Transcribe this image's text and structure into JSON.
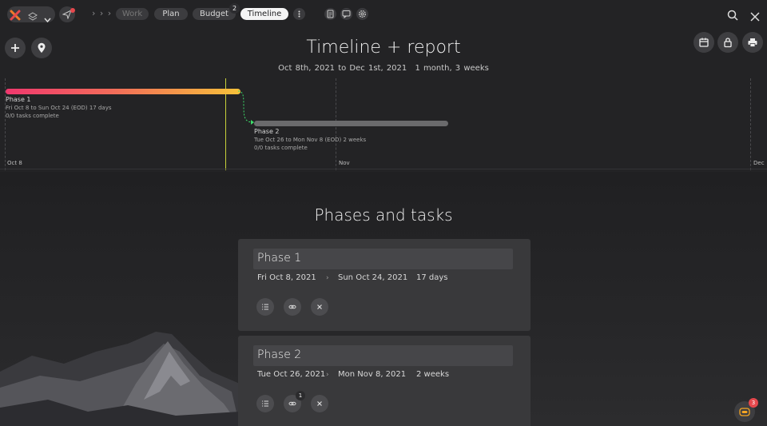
{
  "topbar": {
    "crumbs": "› › ›",
    "tabs": [
      {
        "label": "Work"
      },
      {
        "label": "Plan"
      },
      {
        "label": "Budget",
        "badge": "2"
      },
      {
        "label": "Timeline"
      }
    ]
  },
  "header": {
    "title": "Timeline + report",
    "date_range": "Oct 8th, 2021 to Dec 1st, 2021",
    "duration": "1 month, 3 weeks"
  },
  "timeline": {
    "months": [
      "Oct 8",
      "Nov",
      "Dec"
    ],
    "phases": [
      {
        "name": "Phase 1",
        "range": "Fri Oct 8 to Sun Oct 24 (EOD) 17 days",
        "tasks": "0/0 tasks complete"
      },
      {
        "name": "Phase 2",
        "range": "Tue Oct 26 to Mon Nov 8 (EOD) 2 weeks",
        "tasks": "0/0 tasks complete"
      }
    ]
  },
  "section": {
    "title": "Phases and tasks"
  },
  "cards": [
    {
      "name": "Phase 1",
      "start": "Fri Oct 8, 2021",
      "arrow": "›",
      "end": "Sun Oct 24, 2021",
      "duration": "17 days"
    },
    {
      "name": "Phase 2",
      "start": "Tue Oct 26, 2021",
      "arrow": "›",
      "end": "Mon Nov 8, 2021",
      "duration": "2 weeks",
      "link_count": "1"
    }
  ],
  "help": {
    "badge": "3"
  },
  "colors": {
    "background": "#232325",
    "phase1_start": "#f0386e",
    "phase1_end": "#f7c23a",
    "today_line": "#c8d23a",
    "dependency": "#3ddc6a",
    "badge": "#e5484d"
  }
}
